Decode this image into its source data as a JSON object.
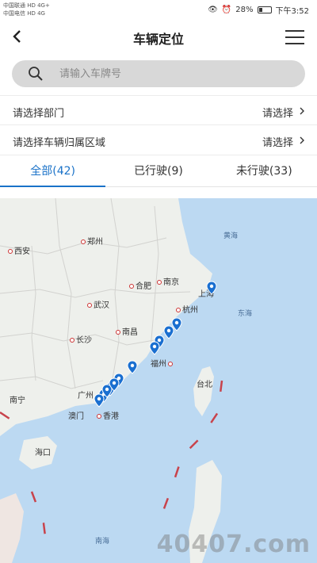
{
  "status_bar": {
    "carrier_1": "中国联通 HD 4G+",
    "carrier_2": "中国电信 HD 4G",
    "battery": "28%",
    "time": "下午3:52"
  },
  "header": {
    "title": "车辆定位"
  },
  "search": {
    "placeholder": "请输入车牌号"
  },
  "filters": [
    {
      "label": "请选择部门",
      "value": "请选择"
    },
    {
      "label": "请选择车辆归属区域",
      "value": "请选择"
    }
  ],
  "tabs": [
    {
      "label": "全部(42)",
      "active": true
    },
    {
      "label": "已行驶(9)",
      "active": false
    },
    {
      "label": "未行驶(33)",
      "active": false
    }
  ],
  "map": {
    "cities": [
      "郑州",
      "西安",
      "合肥",
      "南京",
      "上海",
      "武汉",
      "杭州",
      "南昌",
      "长沙",
      "福州",
      "台北",
      "南宁",
      "广州",
      "澳门",
      "香港",
      "海口"
    ],
    "seas": [
      "黄海",
      "东海",
      "南海"
    ],
    "pin_color": "#1a6fd0",
    "vehicle_pins_shown": 12
  },
  "watermark": "40407.com",
  "colors": {
    "accent": "#1a72c8",
    "search_bg": "#d8d8d8"
  }
}
